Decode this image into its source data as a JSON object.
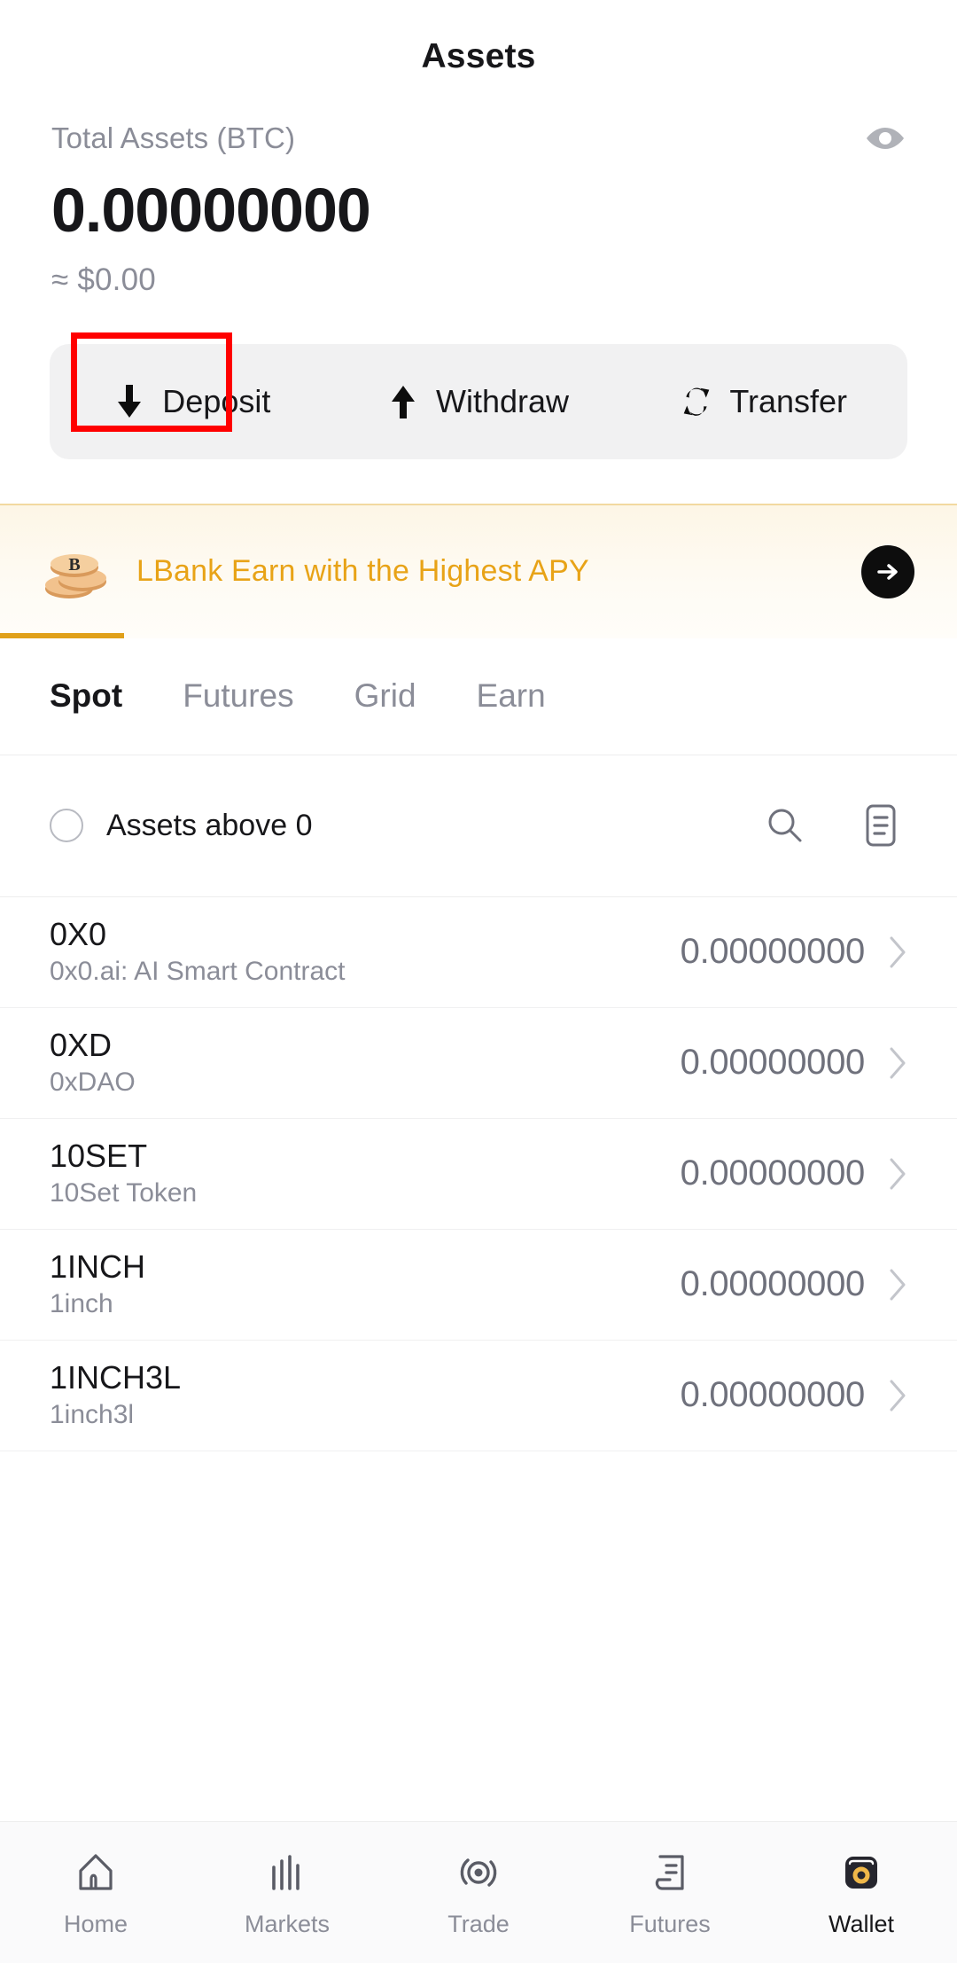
{
  "header": {
    "title": "Assets"
  },
  "balance": {
    "label": "Total Assets (BTC)",
    "value": "0.00000000",
    "fiat": "≈ $0.00",
    "eye_icon": "eye-icon"
  },
  "actions": [
    {
      "label": "Deposit",
      "icon": "arrow-down-icon",
      "highlighted": true
    },
    {
      "label": "Withdraw",
      "icon": "arrow-up-icon",
      "highlighted": false
    },
    {
      "label": "Transfer",
      "icon": "transfer-swap-icon",
      "highlighted": false
    }
  ],
  "promo": {
    "text": "LBank Earn with the Highest APY",
    "coin_icon": "bitcoin-coins-icon",
    "arrow_icon": "arrow-right-icon"
  },
  "tabs": [
    {
      "label": "Spot",
      "active": true
    },
    {
      "label": "Futures",
      "active": false
    },
    {
      "label": "Grid",
      "active": false
    },
    {
      "label": "Earn",
      "active": false
    }
  ],
  "filter": {
    "label": "Assets above 0",
    "checked": false,
    "search_icon": "search-icon",
    "records_icon": "records-icon"
  },
  "assets": [
    {
      "symbol": "0X0",
      "name": "0x0.ai: AI Smart Contract",
      "amount": "0.00000000"
    },
    {
      "symbol": "0XD",
      "name": "0xDAO",
      "amount": "0.00000000"
    },
    {
      "symbol": "10SET",
      "name": "10Set Token",
      "amount": "0.00000000"
    },
    {
      "symbol": "1INCH",
      "name": "1inch",
      "amount": "0.00000000"
    },
    {
      "symbol": "1INCH3L",
      "name": "1inch3l",
      "amount": "0.00000000"
    }
  ],
  "bottom_nav": [
    {
      "label": "Home",
      "icon": "home-icon",
      "active": false
    },
    {
      "label": "Markets",
      "icon": "markets-icon",
      "active": false
    },
    {
      "label": "Trade",
      "icon": "trade-icon",
      "active": false
    },
    {
      "label": "Futures",
      "icon": "futures-icon",
      "active": false
    },
    {
      "label": "Wallet",
      "icon": "wallet-icon",
      "active": true
    }
  ],
  "colors": {
    "accent_orange": "#e8a317",
    "highlight_red": "#ff0000",
    "text_primary": "#17171a",
    "text_muted": "#8b8d98",
    "wallet_icon_dark": "#26262e",
    "wallet_icon_gold": "#f0b849"
  }
}
